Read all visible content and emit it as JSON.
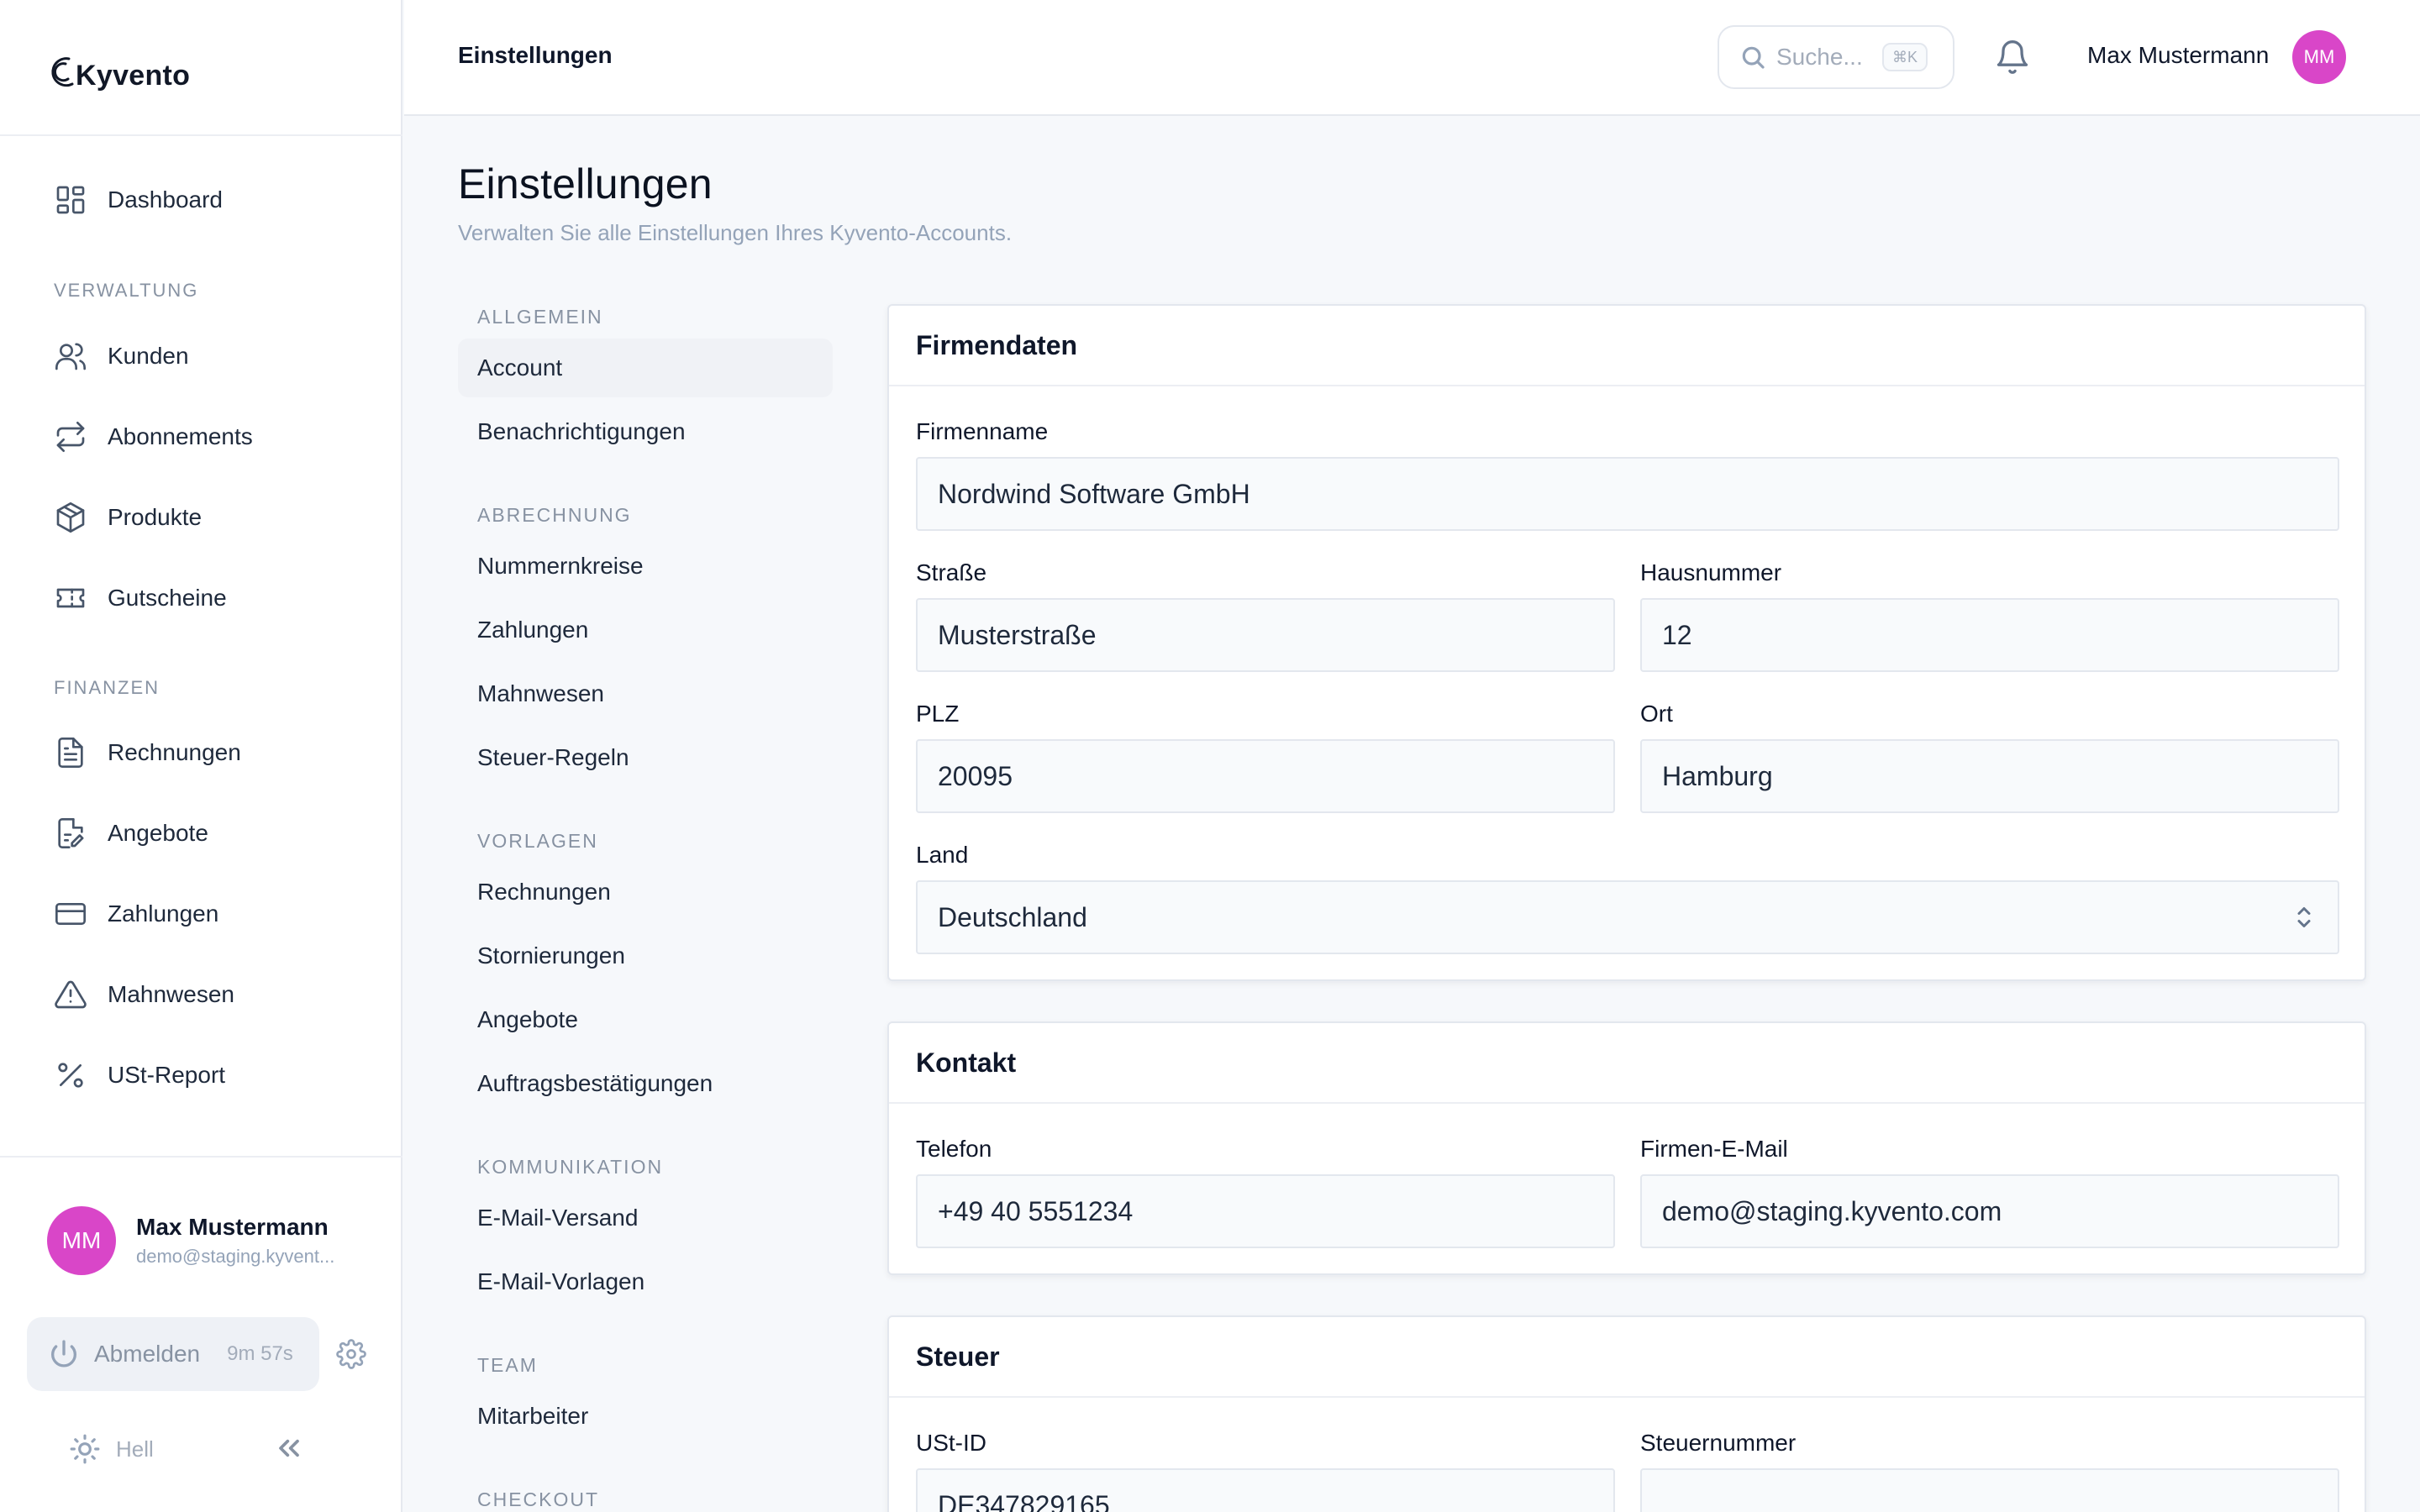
{
  "app": {
    "name": "Kyvento"
  },
  "sidebar": {
    "dashboard": "Dashboard",
    "section_verwaltung": "VERWALTUNG",
    "section_finanzen": "FINANZEN",
    "items": {
      "kunden": "Kunden",
      "abonnements": "Abonnements",
      "produkte": "Produkte",
      "gutscheine": "Gutscheine",
      "rechnungen": "Rechnungen",
      "angebote": "Angebote",
      "zahlungen": "Zahlungen",
      "mahnwesen": "Mahnwesen",
      "ust_report": "USt-Report"
    },
    "user": {
      "initials": "MM",
      "name": "Max Mustermann",
      "email": "demo@staging.kyvent..."
    },
    "logout": {
      "label": "Abmelden",
      "timer": "9m 57s"
    },
    "theme": {
      "label": "Hell"
    }
  },
  "topbar": {
    "title": "Einstellungen",
    "search_placeholder": "Suche...",
    "search_shortcut": "⌘K",
    "user_name": "Max Mustermann",
    "user_initials": "MM"
  },
  "page": {
    "title": "Einstellungen",
    "subtitle": "Verwalten Sie alle Einstellungen Ihres Kyvento-Accounts."
  },
  "settings_nav": {
    "allgemein": {
      "title": "ALLGEMEIN",
      "items": [
        "Account",
        "Benachrichtigungen"
      ]
    },
    "abrechnung": {
      "title": "ABRECHNUNG",
      "items": [
        "Nummernkreise",
        "Zahlungen",
        "Mahnwesen",
        "Steuer-Regeln"
      ]
    },
    "vorlagen": {
      "title": "VORLAGEN",
      "items": [
        "Rechnungen",
        "Stornierungen",
        "Angebote",
        "Auftragsbestätigungen"
      ]
    },
    "kommunikation": {
      "title": "KOMMUNIKATION",
      "items": [
        "E-Mail-Versand",
        "E-Mail-Vorlagen"
      ]
    },
    "team": {
      "title": "TEAM",
      "items": [
        "Mitarbeiter"
      ]
    },
    "checkout": {
      "title": "CHECKOUT"
    },
    "active": "Account"
  },
  "firmendaten": {
    "title": "Firmendaten",
    "firmenname": {
      "label": "Firmenname",
      "value": "Nordwind Software GmbH"
    },
    "strasse": {
      "label": "Straße",
      "value": "Musterstraße"
    },
    "hausnummer": {
      "label": "Hausnummer",
      "value": "12"
    },
    "plz": {
      "label": "PLZ",
      "value": "20095"
    },
    "ort": {
      "label": "Ort",
      "value": "Hamburg"
    },
    "land": {
      "label": "Land",
      "value": "Deutschland"
    }
  },
  "kontakt": {
    "title": "Kontakt",
    "telefon": {
      "label": "Telefon",
      "value": "+49 40 5551234"
    },
    "email": {
      "label": "Firmen-E-Mail",
      "value": "demo@staging.kyvento.com"
    }
  },
  "steuer": {
    "title": "Steuer",
    "ust_id": {
      "label": "USt-ID",
      "value": "DE347829165"
    },
    "steuernummer": {
      "label": "Steuernummer",
      "value": ""
    }
  },
  "colors": {
    "accent_avatar": "#d946c8",
    "background": "#f6f8fb",
    "surface": "#ffffff"
  }
}
